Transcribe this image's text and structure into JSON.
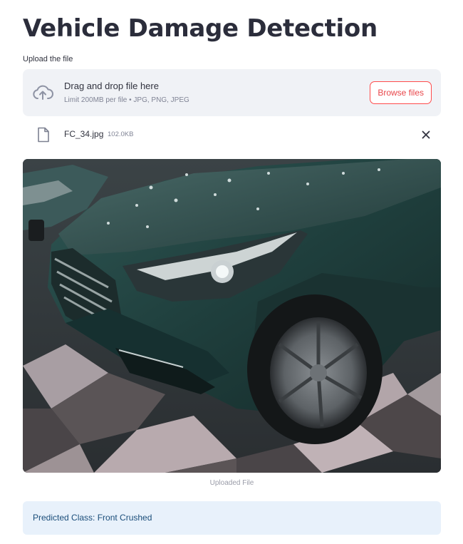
{
  "header": {
    "title": "Vehicle Damage Detection"
  },
  "uploader": {
    "label": "Upload the file",
    "drop_text": "Drag and drop file here",
    "limit_hint": "Limit 200MB per file • JPG, PNG, JPEG",
    "browse_label": "Browse files",
    "icon": "cloud-upload-icon"
  },
  "uploaded_file": {
    "name": "FC_34.jpg",
    "size": "102.0KB",
    "icon": "file-icon"
  },
  "image": {
    "caption": "Uploaded File"
  },
  "result": {
    "text": "Predicted Class: Front Crushed"
  },
  "colors": {
    "accent": "#ff4b4b",
    "dropzone_bg": "#f0f2f6",
    "info_bg": "#e8f1fb",
    "info_text": "#1a4d7a"
  }
}
